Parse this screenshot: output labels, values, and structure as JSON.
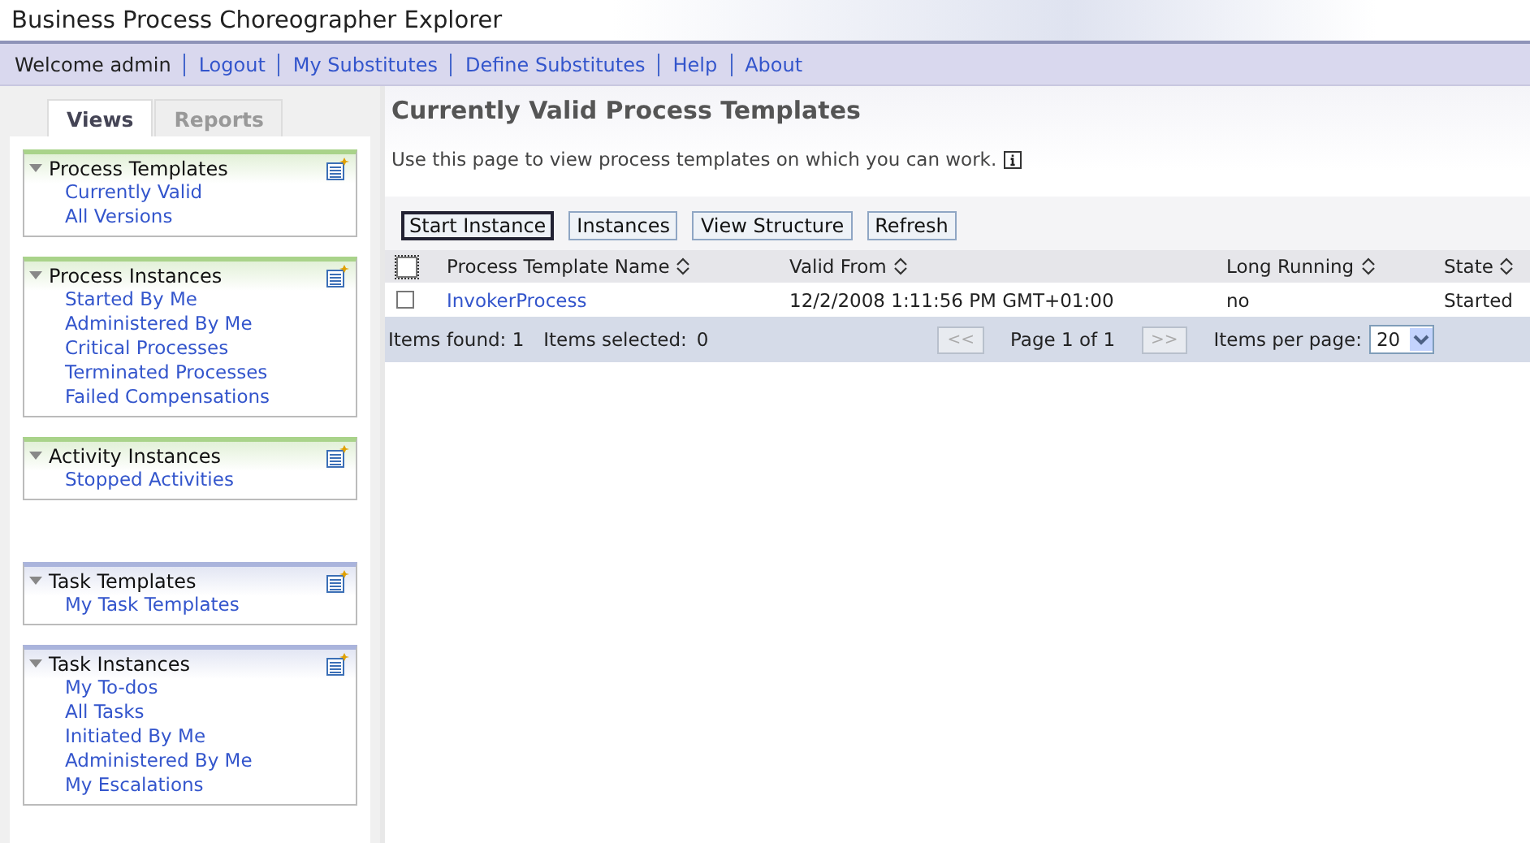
{
  "window": {
    "title": "Business Process Choreographer Explorer"
  },
  "nav": {
    "welcome": "Welcome admin",
    "links": [
      "Logout",
      "My Substitutes",
      "Define Substitutes",
      "Help",
      "About"
    ]
  },
  "tabs": [
    {
      "label": "Views",
      "selected": true
    },
    {
      "label": "Reports",
      "selected": false
    }
  ],
  "sections": [
    {
      "title": "Process Templates",
      "color": "#a9d38a",
      "items": [
        "Currently Valid",
        "All Versions"
      ]
    },
    {
      "title": "Process Instances",
      "color": "#a9d38a",
      "items": [
        "Started By Me",
        "Administered By Me",
        "Critical Processes",
        "Terminated Processes",
        "Failed Compensations"
      ]
    },
    {
      "title": "Activity Instances",
      "color": "#a9d38a",
      "items": [
        "Stopped Activities"
      ]
    },
    {
      "title": "Task Templates",
      "color": "#aab4dc",
      "items": [
        "My Task Templates"
      ]
    },
    {
      "title": "Task Instances",
      "color": "#aab4dc",
      "items": [
        "My To-dos",
        "All Tasks",
        "Initiated By Me",
        "Administered By Me",
        "My Escalations"
      ]
    }
  ],
  "page": {
    "title": "Currently Valid Process Templates",
    "description": "Use this page to view process templates on which you can work."
  },
  "buttons": [
    {
      "label": "Start Instance",
      "default": true
    },
    {
      "label": "Instances",
      "default": false
    },
    {
      "label": "View Structure",
      "default": false
    },
    {
      "label": "Refresh",
      "default": false
    }
  ],
  "table": {
    "select_all_checked": false,
    "columns": [
      "Process Template Name",
      "Valid From",
      "Long Running",
      "State"
    ],
    "rows": [
      {
        "checked": false,
        "cells": [
          "InvokerProcess",
          "12/2/2008 1:11:56 PM GMT+01:00",
          "no",
          "Started"
        ]
      }
    ]
  },
  "footer": {
    "items_found": "Items found: 1",
    "items_selected_label": "Items selected:",
    "items_selected": "0",
    "prev": "<<",
    "page": "Page 1 of 1",
    "next": ">>",
    "per_page_label": "Items per page:",
    "per_page": "20"
  }
}
